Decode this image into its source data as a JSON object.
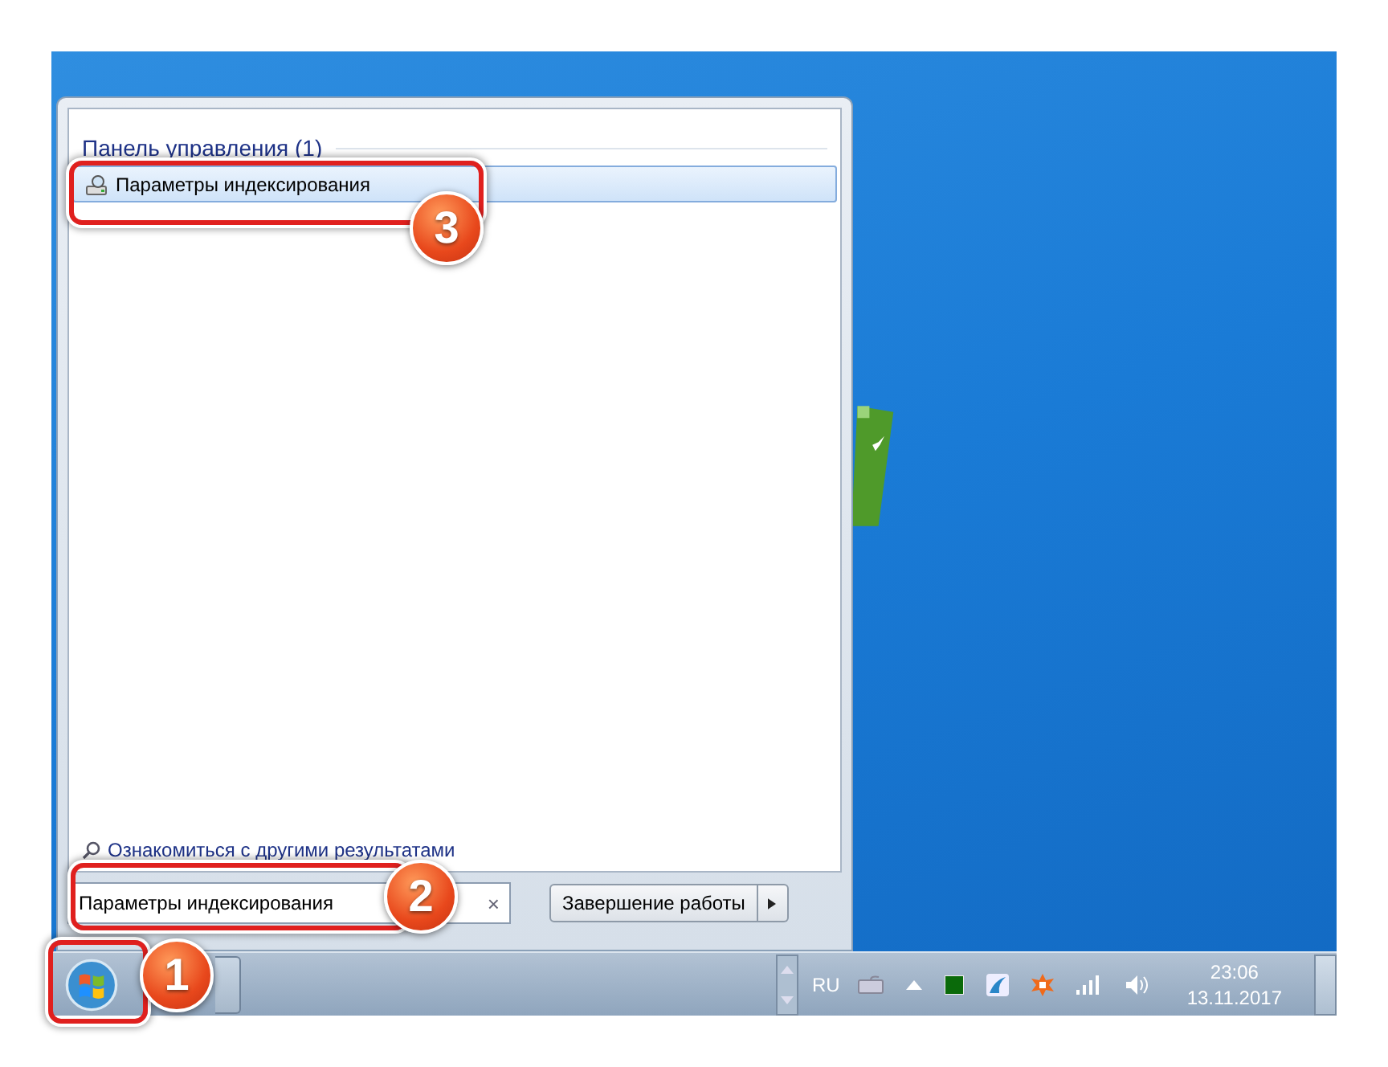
{
  "start_menu": {
    "group_title": "Панель управления (1)",
    "results": [
      {
        "label": "Параметры индексирования",
        "selected": true
      }
    ],
    "more_results": "Ознакомиться с другими результатами",
    "search": {
      "value": "Параметры индексирования",
      "clear": "×"
    },
    "shutdown": {
      "label": "Завершение работы"
    }
  },
  "taskbar": {
    "language": "RU",
    "clock_time": "23:06",
    "clock_date": "13.11.2017"
  },
  "annotations": [
    {
      "number": "1"
    },
    {
      "number": "2"
    },
    {
      "number": "3"
    }
  ]
}
